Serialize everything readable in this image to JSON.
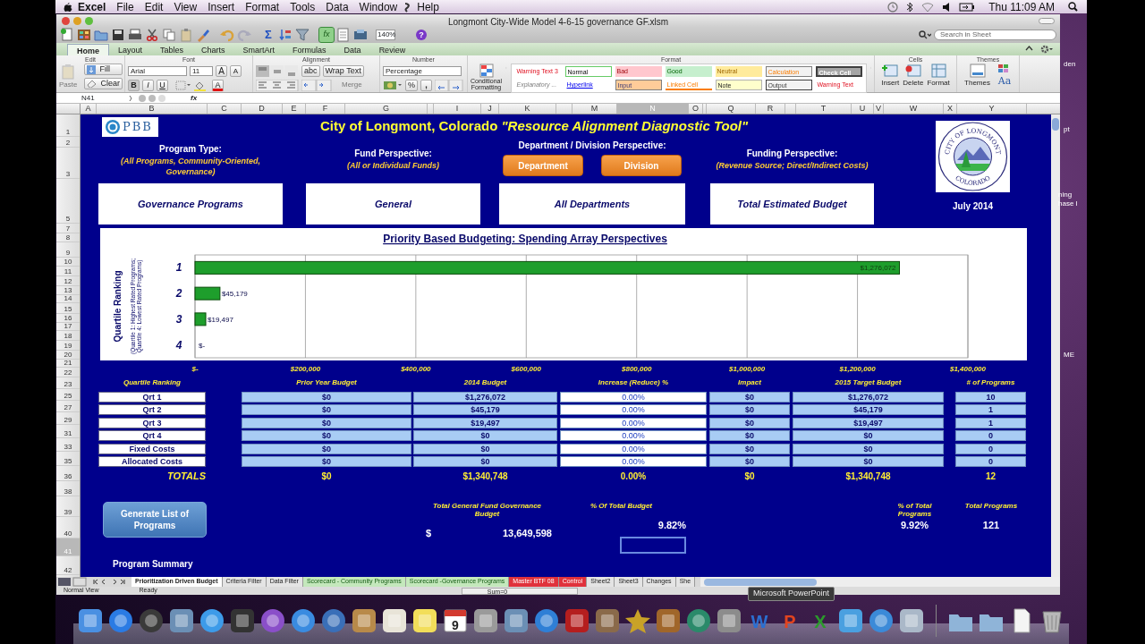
{
  "menu_bar": {
    "app": "Excel",
    "items": [
      "File",
      "Edit",
      "View",
      "Insert",
      "Format",
      "Tools",
      "Data",
      "Window",
      "Help"
    ],
    "clock": "Thu 11:09 AM"
  },
  "window": {
    "title": "Longmont City-Wide Model 4-6-15 governance GF.xlsm"
  },
  "toolbar": {
    "items": [
      {
        "kind": "new",
        "on": false
      },
      {
        "kind": "gallery",
        "on": false
      },
      {
        "kind": "open",
        "on": false
      },
      {
        "kind": "save",
        "on": false
      },
      {
        "kind": "print",
        "on": false
      },
      {
        "kind": "cut",
        "on": false
      },
      {
        "kind": "copy",
        "on": false
      },
      {
        "kind": "paste",
        "on": false
      },
      {
        "kind": "brush",
        "on": false
      },
      {
        "kind": "undo",
        "on": false
      },
      {
        "kind": "redo",
        "on": false
      },
      {
        "kind": "sum",
        "label": "Σ",
        "on": false
      },
      {
        "kind": "sort",
        "on": false
      },
      {
        "kind": "filter",
        "on": false
      },
      {
        "kind": "fx",
        "label": "fx",
        "on": true
      },
      {
        "kind": "toolbox",
        "on": false
      },
      {
        "kind": "media",
        "on": false
      }
    ],
    "zoom": "140%",
    "help": "?",
    "search": {
      "placeholder": "Search in Sheet"
    }
  },
  "ribbon": {
    "tabs": [
      {
        "label": "Home",
        "selected": true
      },
      {
        "label": "Layout",
        "selected": false
      },
      {
        "label": "Tables",
        "selected": false
      },
      {
        "label": "Charts",
        "selected": false
      },
      {
        "label": "SmartArt",
        "selected": false
      },
      {
        "label": "Formulas",
        "selected": false
      },
      {
        "label": "Data",
        "selected": false
      },
      {
        "label": "Review",
        "selected": false
      }
    ],
    "groups": [
      "Edit",
      "Font",
      "Alignment",
      "Number",
      "Format",
      "Cells",
      "Themes"
    ],
    "paste": {
      "label": "Paste",
      "disabled": true
    },
    "fill": "Fill",
    "clear": "Clear",
    "font_name": "Arial",
    "font_size": "11",
    "grow": "A",
    "shrink": "A",
    "bold": "B",
    "italic": "I",
    "underline": "U",
    "font_color": "A",
    "orientation": "abc",
    "wrap_text": "Wrap Text",
    "merge": {
      "label": "Merge",
      "disabled": true
    },
    "number_format": "Percentage",
    "percent": "%",
    "comma": ",",
    "conditional_formatting": "Conditional Formatting",
    "cell_styles": [
      {
        "label": "Warning Text 3",
        "kind": "warning"
      },
      {
        "label": "Normal",
        "kind": "normal"
      },
      {
        "label": "Bad",
        "kind": "bad"
      },
      {
        "label": "Good",
        "kind": "good"
      },
      {
        "label": "Neutral",
        "kind": "neutral"
      },
      {
        "label": "Calculation",
        "kind": "calculation"
      },
      {
        "label": "Check Cell",
        "kind": "check"
      },
      {
        "label": "Explanatory ...",
        "kind": "explanatory"
      },
      {
        "label": "Hyperlink",
        "kind": "hyperlink"
      },
      {
        "label": "Input",
        "kind": "input"
      },
      {
        "label": "Linked Cell",
        "kind": "linked"
      },
      {
        "label": "Note",
        "kind": "note"
      },
      {
        "label": "Output",
        "kind": "output"
      },
      {
        "label": "Warning Text",
        "kind": "warning"
      }
    ],
    "insert": "Insert",
    "delete": "Delete",
    "format": "Format",
    "themes": "Themes",
    "theme_fonts": "Aa"
  },
  "formula_bar": {
    "name_box": "N41",
    "fx": "fx"
  },
  "sheet": {
    "col_headers": [
      {
        "label": "A",
        "selected": false
      },
      {
        "label": "B",
        "selected": false
      },
      {
        "label": "C",
        "selected": false
      },
      {
        "label": "D",
        "selected": false
      },
      {
        "label": "E",
        "selected": false
      },
      {
        "label": "F",
        "selected": false
      },
      {
        "label": "G",
        "selected": false
      },
      {
        "label": "I",
        "selected": false
      },
      {
        "label": "J",
        "selected": false
      },
      {
        "label": "K",
        "selected": false
      },
      {
        "label": "M",
        "selected": false
      },
      {
        "label": "N",
        "selected": true
      },
      {
        "label": "O",
        "selected": false
      },
      {
        "label": "Q",
        "selected": false
      },
      {
        "label": "R",
        "selected": false
      },
      {
        "label": "T",
        "selected": false
      },
      {
        "label": "U",
        "selected": false
      },
      {
        "label": "V",
        "selected": false
      },
      {
        "label": "W",
        "selected": false
      },
      {
        "label": "X",
        "selected": false
      },
      {
        "label": "Y",
        "selected": false
      }
    ],
    "row_headers": [
      {
        "label": "1",
        "selected": false
      },
      {
        "label": "2",
        "selected": false
      },
      {
        "label": "3",
        "selected": false
      },
      {
        "label": "5",
        "selected": false
      },
      {
        "label": "7",
        "selected": false
      },
      {
        "label": "8",
        "selected": false
      },
      {
        "label": "9",
        "selected": false
      },
      {
        "label": "10",
        "selected": false
      },
      {
        "label": "11",
        "selected": false
      },
      {
        "label": "12",
        "selected": false
      },
      {
        "label": "13",
        "selected": false
      },
      {
        "label": "14",
        "selected": false
      },
      {
        "label": "15",
        "selected": false
      },
      {
        "label": "16",
        "selected": false
      },
      {
        "label": "17",
        "selected": false
      },
      {
        "label": "18",
        "selected": false
      },
      {
        "label": "19",
        "selected": false
      },
      {
        "label": "20",
        "selected": false
      },
      {
        "label": "21",
        "selected": false
      },
      {
        "label": "22",
        "selected": false
      },
      {
        "label": "23",
        "selected": false
      },
      {
        "label": "25",
        "selected": false
      },
      {
        "label": "27",
        "selected": false
      },
      {
        "label": "29",
        "selected": false
      },
      {
        "label": "31",
        "selected": false
      },
      {
        "label": "33",
        "selected": false
      },
      {
        "label": "35",
        "selected": false
      },
      {
        "label": "36",
        "selected": false
      },
      {
        "label": "38",
        "selected": false
      },
      {
        "label": "39",
        "selected": false
      },
      {
        "label": "40",
        "selected": false
      },
      {
        "label": "41",
        "selected": true
      },
      {
        "label": "42",
        "selected": false
      }
    ],
    "logo": "PBB",
    "title": "City of Longmont, Colorado",
    "title_tag": "\"Resource Alignment Diagnostic Tool\"",
    "perspectives": [
      {
        "label": "Program Type:",
        "note": "(All Programs, Community-Oriented, Governance)",
        "value": "Governance Programs"
      },
      {
        "label": "Fund Perspective:",
        "note": "(All or Individual Funds)",
        "value": "General"
      },
      {
        "label": "Department / Division Perspective:",
        "buttons": [
          "Department",
          "Division"
        ],
        "value": "All Departments"
      },
      {
        "label": "Funding Perspective:",
        "note": "(Revenue Source; Direct/Indirect Costs)",
        "value": "Total Estimated Budget"
      }
    ],
    "seal": {
      "top": "CITY OF LONGMONT",
      "bottom": "COLORADO"
    },
    "date": "July 2014",
    "chart_data": {
      "type": "bar",
      "orientation": "horizontal",
      "title": "Priority Based Budgeting: Spending Array Perspectives",
      "grid": true,
      "annotations": [
        {
          "text": "Quartile Ranking"
        },
        {
          "text": "(Quartile 1: Highest Rated Programs;"
        },
        {
          "text": "Quartile 4: Lowest Rated Programs)"
        }
      ],
      "categories": [
        "1",
        "2",
        "3",
        "4"
      ],
      "series": [
        {
          "color": "#1e9e2c",
          "values": [
            1276072,
            45179,
            19497,
            0
          ]
        }
      ],
      "value_labels": [
        "$1,276,072",
        "$45,179",
        "$19,497",
        "$-"
      ],
      "xlim": [
        0,
        1400000
      ],
      "xticks": [
        {
          "value": 0,
          "label": "$-"
        },
        {
          "value": 200000,
          "label": "$200,000"
        },
        {
          "value": 400000,
          "label": "$400,000"
        },
        {
          "value": 600000,
          "label": "$600,000"
        },
        {
          "value": 800000,
          "label": "$800,000"
        },
        {
          "value": 1000000,
          "label": "$1,000,000"
        },
        {
          "value": 1200000,
          "label": "$1,200,000"
        },
        {
          "value": 1400000,
          "label": "$1,400,000"
        }
      ]
    },
    "budget_table": {
      "columns": [
        "Quartile Ranking",
        "Prior Year Budget",
        "2014 Budget",
        "Increase (Reduce) %",
        "Impact",
        "2015 Target Budget",
        "# of Programs"
      ],
      "rows": [
        {
          "cells": [
            "Qrt 1",
            "$0",
            "$1,276,072",
            "0.00%",
            "$0",
            "$1,276,072",
            "10"
          ]
        },
        {
          "cells": [
            "Qrt 2",
            "$0",
            "$45,179",
            "0.00%",
            "$0",
            "$45,179",
            "1"
          ]
        },
        {
          "cells": [
            "Qrt 3",
            "$0",
            "$19,497",
            "0.00%",
            "$0",
            "$19,497",
            "1"
          ]
        },
        {
          "cells": [
            "Qrt 4",
            "$0",
            "$0",
            "0.00%",
            "$0",
            "$0",
            "0"
          ]
        },
        {
          "cells": [
            "Fixed Costs",
            "$0",
            "$0",
            "0.00%",
            "$0",
            "$0",
            "0"
          ]
        },
        {
          "cells": [
            "Allocated Costs",
            "$0",
            "$0",
            "0.00%",
            "$0",
            "$0",
            "0"
          ]
        }
      ],
      "totals": {
        "cells": [
          "TOTALS",
          "$0",
          "$1,340,748",
          "0.00%",
          "$0",
          "$1,340,748",
          "12"
        ]
      }
    },
    "generate_button": "Generate List of Programs",
    "summary": [
      {
        "label": "Total General Fund Governance Budget",
        "currency": "$",
        "value": "13,649,598"
      },
      {
        "label": "% Of Total Budget",
        "value": "9.82%"
      },
      {
        "label": "% of Total Programs",
        "value": "9.92%"
      },
      {
        "label": "Total Programs",
        "value": "121"
      }
    ],
    "program_summary": "Program Summary"
  },
  "sheet_tabs": [
    {
      "label": "Prioritization Driven Budget",
      "selected": true
    },
    {
      "label": "Criteria Filter",
      "selected": false
    },
    {
      "label": "Data Filter",
      "selected": false
    },
    {
      "label": "Scorecard - Community Programs",
      "selected": false,
      "color": "#c4e8bc"
    },
    {
      "label": "Scorecard -Governance Programs",
      "selected": false,
      "color": "#c4e8bc"
    },
    {
      "label": "Master BTF 08",
      "selected": false,
      "color": "#e0323c"
    },
    {
      "label": "Control",
      "selected": false,
      "color": "#e0323c"
    },
    {
      "label": "Sheet2",
      "selected": false
    },
    {
      "label": "Sheet3",
      "selected": false
    },
    {
      "label": "Changes",
      "selected": false
    },
    {
      "label": "She",
      "selected": false
    }
  ],
  "status_bar": {
    "view": "Normal View",
    "state": "Ready",
    "sum": "Sum=0"
  },
  "tooltip": "Microsoft PowerPoint",
  "desktop_labels": [
    "den",
    "pt",
    "ning",
    "hase I",
    "ME"
  ],
  "dock": [
    {
      "kind": "tile",
      "color": "#4a90e2"
    },
    {
      "kind": "circle",
      "color": "#2a7be4"
    },
    {
      "kind": "circle",
      "color": "#3a3a3a"
    },
    {
      "kind": "tile",
      "color": "#6b8fb5"
    },
    {
      "kind": "circle",
      "color": "#3d9be9"
    },
    {
      "kind": "tile",
      "color": "#333333"
    },
    {
      "kind": "circle",
      "color": "#8a4fc9"
    },
    {
      "kind": "circle",
      "color": "#3a8be0"
    },
    {
      "kind": "circle",
      "color": "#3a6fb8"
    },
    {
      "kind": "tile",
      "color": "#b88a4a"
    },
    {
      "kind": "tile",
      "color": "#e8e4d8"
    },
    {
      "kind": "tile",
      "color": "#f2de5a"
    },
    {
      "kind": "calendar",
      "color": "#d33a2f",
      "label": "9"
    },
    {
      "kind": "tile",
      "color": "#9a9a9a"
    },
    {
      "kind": "tile",
      "color": "#6b8fb5"
    },
    {
      "kind": "circle",
      "color": "#2f7fd6"
    },
    {
      "kind": "tile",
      "color": "#b51e1e"
    },
    {
      "kind": "tile",
      "color": "#8a6a4a"
    },
    {
      "kind": "star",
      "color": "#c9a227"
    },
    {
      "kind": "tile",
      "color": "#a0662a"
    },
    {
      "kind": "circle",
      "color": "#2a8a6a"
    },
    {
      "kind": "tile",
      "color": "#8c8c8c"
    },
    {
      "kind": "letter",
      "color": "#2b6fd1",
      "label": "W"
    },
    {
      "kind": "letter",
      "color": "#e2441f",
      "label": "P"
    },
    {
      "kind": "letter",
      "color": "#2b9a2b",
      "label": "X"
    },
    {
      "kind": "tile",
      "color": "#4aa0e0"
    },
    {
      "kind": "circle",
      "color": "#3b8ad8"
    },
    {
      "kind": "tile",
      "color": "#aab8c8"
    },
    {
      "kind": "folder",
      "color": "#8fb4d8"
    },
    {
      "kind": "folder",
      "color": "#8fb4d8"
    },
    {
      "kind": "doc",
      "color": "#f4f4f4"
    },
    {
      "kind": "trash",
      "color": "#b8b8b8"
    }
  ]
}
